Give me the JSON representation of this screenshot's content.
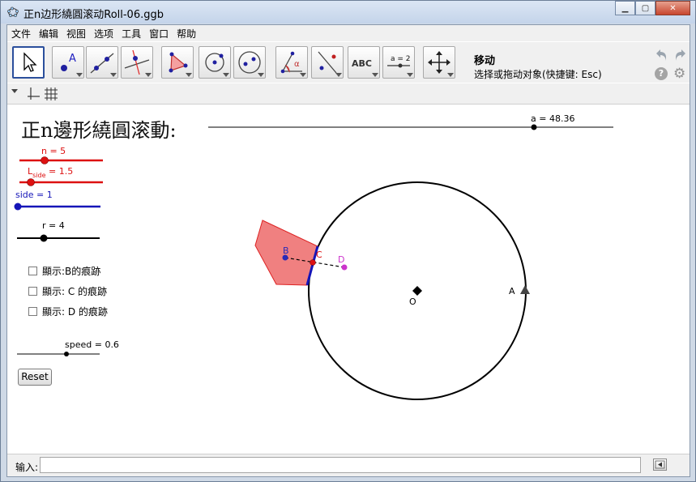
{
  "window": {
    "title": "正n边形繞圓滚动Roll-06.ggb",
    "minimize": "▁",
    "maximize": "▢",
    "close": "✕"
  },
  "menu": [
    "文件",
    "编辑",
    "视图",
    "选项",
    "工具",
    "窗口",
    "帮助"
  ],
  "toolbar": {
    "tool_name": "移动",
    "tool_help": "选择或拖动对象(快捷键: Esc)",
    "abc_label": "ABC",
    "slider_label": "a = 2",
    "help_label": "?",
    "icons": [
      "move-icon",
      "point-icon",
      "line-icon",
      "perpendicular-line-icon",
      "polygon-icon",
      "circle-icon",
      "ellipse-icon",
      "angle-icon",
      "reflect-icon",
      "text-icon",
      "slider-icon",
      "move-graphics-icon"
    ]
  },
  "graphics": {
    "heading": "正n邊形繞圓滚動:",
    "sliders": {
      "a": "a = 48.36",
      "n": "n = 5",
      "l_side_L": "L",
      "l_side_sub": "side",
      "l_side_val": " = 1.5",
      "side": "side = 1",
      "r": "r = 4",
      "speed": "speed = 0.6"
    },
    "checkboxes": [
      "顯示:B的痕跡",
      "顯示: C 的痕跡",
      "顯示: D 的痕跡"
    ],
    "reset_label": "Reset",
    "points": {
      "A": "A",
      "B": "B",
      "C": "C",
      "D": "D",
      "O": "O"
    },
    "colors": {
      "red": "#dd1111",
      "blue": "#1515b8",
      "pentagon_fill": "#f08080",
      "magenta": "#cc33cc"
    }
  },
  "input": {
    "label": "输入:"
  }
}
